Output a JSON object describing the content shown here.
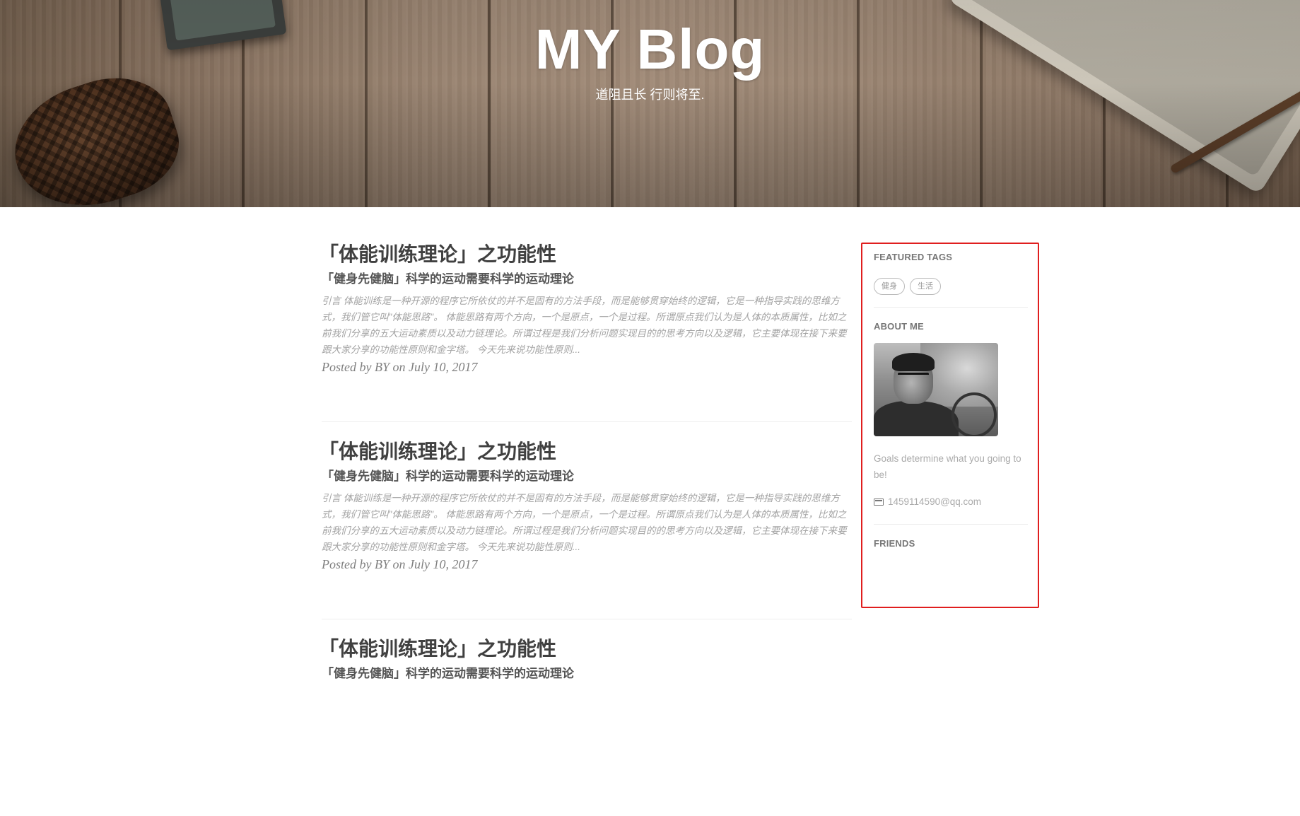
{
  "header": {
    "title": "MY Blog",
    "subtitle": "道阻且长 行则将至."
  },
  "posts": [
    {
      "title": "「体能训练理论」之功能性",
      "subtitle": "「健身先健脑」科学的运动需要科学的运动理论",
      "excerpt": "引言 体能训练是一种开源的程序它所依仗的并不是固有的方法手段，而是能够贯穿始终的逻辑，它是一种指导实践的思维方式，我们管它叫\"体能思路\"。 体能思路有两个方向，一个是原点，一个是过程。所谓原点我们认为是人体的本质属性，比如之前我们分享的五大运动素质以及动力链理论。所谓过程是我们分析问题实现目的的思考方向以及逻辑，它主要体现在接下来要跟大家分享的功能性原则和金字塔。 今天先来说功能性原则...",
      "meta": "Posted by BY on July 10, 2017"
    },
    {
      "title": "「体能训练理论」之功能性",
      "subtitle": "「健身先健脑」科学的运动需要科学的运动理论",
      "excerpt": "引言 体能训练是一种开源的程序它所依仗的并不是固有的方法手段，而是能够贯穿始终的逻辑，它是一种指导实践的思维方式，我们管它叫\"体能思路\"。 体能思路有两个方向，一个是原点，一个是过程。所谓原点我们认为是人体的本质属性，比如之前我们分享的五大运动素质以及动力链理论。所谓过程是我们分析问题实现目的的思考方向以及逻辑，它主要体现在接下来要跟大家分享的功能性原则和金字塔。 今天先来说功能性原则...",
      "meta": "Posted by BY on July 10, 2017"
    },
    {
      "title": "「体能训练理论」之功能性",
      "subtitle": "「健身先健脑」科学的运动需要科学的运动理论",
      "excerpt": "",
      "meta": ""
    }
  ],
  "sidebar": {
    "featured_tags_heading": "FEATURED TAGS",
    "tags": [
      "健身",
      "生活"
    ],
    "about_heading": "ABOUT ME",
    "about_text": "Goals determine what you going to be!",
    "email": "1459114590@qq.com",
    "friends_heading": "FRIENDS",
    "highlight_color": "#e01e1e"
  }
}
